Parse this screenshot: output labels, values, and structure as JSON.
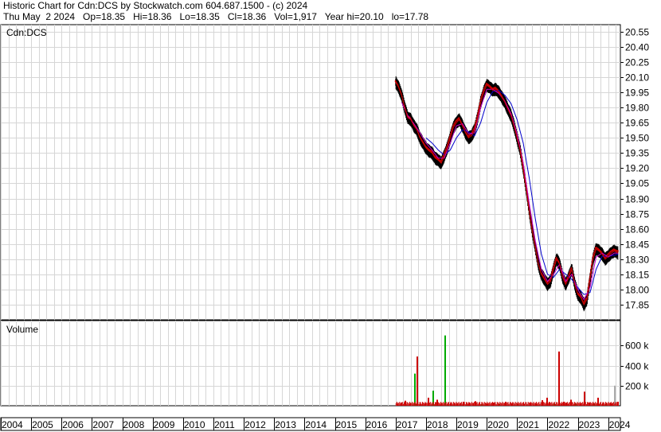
{
  "header": {
    "line1": "Historic Chart for Cdn:DCS by Stockwatch.com 604.687.1500 - (c) 2024",
    "line2": "Thu May  2 2024   Op=18.35   Hi=18.36   Lo=18.35   Cl=18.36   Vol=1,917   Year hi=20.10   lo=17.78"
  },
  "chart_data": [
    {
      "type": "line",
      "title": "Cdn:DCS",
      "ylim": [
        17.7,
        20.62
      ],
      "y_ticks": [
        "20.55",
        "20.40",
        "20.25",
        "20.10",
        "19.95",
        "19.80",
        "19.65",
        "19.50",
        "19.35",
        "19.20",
        "19.05",
        "18.90",
        "18.75",
        "18.60",
        "18.45",
        "18.30",
        "18.15",
        "18.00",
        "17.85"
      ],
      "x_ticks": [
        "2004",
        "2005",
        "2006",
        "2007",
        "2008",
        "2009",
        "2010",
        "2011",
        "2012",
        "2013",
        "2014",
        "2015",
        "2016",
        "2017",
        "2018",
        "2019",
        "2020",
        "2021",
        "2022",
        "2023",
        "2024"
      ],
      "xlim": [
        2004.0,
        2024.4
      ],
      "colors": {
        "price": "#cc0000",
        "ma_short": "#cc00cc",
        "ma_long": "#0000cc",
        "bar": "#000000"
      },
      "series": [
        {
          "kind": "price",
          "x": [
            2017.0,
            2017.1,
            2017.2,
            2017.3,
            2017.4,
            2017.5,
            2017.6,
            2017.7,
            2017.8,
            2017.9,
            2018.0,
            2018.1,
            2018.2,
            2018.3,
            2018.4,
            2018.5,
            2018.6,
            2018.7,
            2018.8,
            2018.9,
            2019.0,
            2019.1,
            2019.2,
            2019.3,
            2019.4,
            2019.5,
            2019.6,
            2019.7,
            2019.8,
            2019.9,
            2020.0,
            2020.1,
            2020.2,
            2020.3,
            2020.4,
            2020.5,
            2020.6,
            2020.7,
            2020.8,
            2020.9,
            2021.0,
            2021.1,
            2021.2,
            2021.3,
            2021.4,
            2021.5,
            2021.6,
            2021.7,
            2021.8,
            2021.9,
            2022.0,
            2022.1,
            2022.2,
            2022.3,
            2022.4,
            2022.5,
            2022.6,
            2022.7,
            2022.8,
            2022.9,
            2023.0,
            2023.1,
            2023.2,
            2023.3,
            2023.4,
            2023.5,
            2023.6,
            2023.7,
            2023.8,
            2023.9,
            2024.0,
            2024.1,
            2024.2,
            2024.33
          ],
          "y": [
            20.05,
            20.0,
            19.92,
            19.8,
            19.7,
            19.68,
            19.62,
            19.58,
            19.5,
            19.45,
            19.4,
            19.37,
            19.35,
            19.3,
            19.28,
            19.25,
            19.32,
            19.4,
            19.5,
            19.6,
            19.65,
            19.68,
            19.62,
            19.55,
            19.5,
            19.52,
            19.58,
            19.7,
            19.85,
            19.95,
            20.02,
            20.0,
            19.97,
            19.98,
            19.95,
            19.9,
            19.85,
            19.78,
            19.72,
            19.62,
            19.5,
            19.38,
            19.2,
            19.0,
            18.78,
            18.58,
            18.42,
            18.25,
            18.15,
            18.1,
            18.05,
            18.08,
            18.2,
            18.3,
            18.25,
            18.12,
            18.05,
            18.12,
            18.2,
            18.05,
            17.95,
            17.92,
            17.85,
            17.9,
            18.1,
            18.3,
            18.4,
            18.38,
            18.35,
            18.3,
            18.33,
            18.36,
            18.38,
            18.36
          ]
        },
        {
          "kind": "ma_short",
          "x": [
            2017.2,
            2017.4,
            2017.6,
            2017.8,
            2018.0,
            2018.2,
            2018.4,
            2018.6,
            2018.8,
            2019.0,
            2019.2,
            2019.4,
            2019.6,
            2019.8,
            2020.0,
            2020.2,
            2020.4,
            2020.6,
            2020.8,
            2021.0,
            2021.2,
            2021.4,
            2021.6,
            2021.8,
            2022.0,
            2022.2,
            2022.4,
            2022.6,
            2022.8,
            2023.0,
            2023.2,
            2023.4,
            2023.6,
            2023.8,
            2024.0,
            2024.2,
            2024.33
          ],
          "y": [
            19.85,
            19.72,
            19.64,
            19.55,
            19.45,
            19.38,
            19.3,
            19.3,
            19.45,
            19.62,
            19.64,
            19.54,
            19.55,
            19.8,
            19.98,
            19.98,
            19.94,
            19.86,
            19.74,
            19.54,
            19.25,
            18.85,
            18.48,
            18.2,
            18.08,
            18.15,
            18.25,
            18.08,
            18.15,
            18.0,
            17.9,
            18.02,
            18.32,
            18.36,
            18.32,
            18.36,
            18.36
          ]
        },
        {
          "kind": "ma_long",
          "x": [
            2018.0,
            2018.2,
            2018.4,
            2018.6,
            2018.8,
            2019.0,
            2019.2,
            2019.4,
            2019.6,
            2019.8,
            2020.0,
            2020.2,
            2020.4,
            2020.6,
            2020.8,
            2021.0,
            2021.2,
            2021.4,
            2021.6,
            2021.8,
            2022.0,
            2022.2,
            2022.4,
            2022.6,
            2022.8,
            2023.0,
            2023.2,
            2023.4,
            2023.6,
            2023.8,
            2024.0,
            2024.2,
            2024.33
          ],
          "y": [
            19.5,
            19.45,
            19.38,
            19.33,
            19.38,
            19.5,
            19.58,
            19.56,
            19.52,
            19.65,
            19.85,
            19.96,
            19.97,
            19.92,
            19.84,
            19.68,
            19.45,
            19.1,
            18.7,
            18.35,
            18.15,
            18.12,
            18.2,
            18.15,
            18.1,
            18.02,
            17.95,
            17.97,
            18.2,
            18.33,
            18.33,
            18.34,
            18.35
          ]
        }
      ]
    },
    {
      "type": "bar",
      "title": "Volume",
      "ylim": [
        0,
        800
      ],
      "y_ticks": [
        "600 k",
        "400 k",
        "200 k"
      ],
      "x": [
        2017.15,
        2017.3,
        2017.45,
        2017.6,
        2017.7,
        2017.8,
        2017.95,
        2018.05,
        2018.2,
        2018.35,
        2018.45,
        2018.6,
        2018.8,
        2019.0,
        2019.2,
        2019.4,
        2019.6,
        2019.8,
        2020.0,
        2020.2,
        2020.4,
        2020.6,
        2020.8,
        2021.0,
        2021.2,
        2021.4,
        2021.6,
        2021.8,
        2021.95,
        2022.05,
        2022.2,
        2022.35,
        2022.5,
        2022.6,
        2022.75,
        2022.9,
        2023.05,
        2023.2,
        2023.35,
        2023.5,
        2023.65,
        2023.8,
        2023.9,
        2024.05,
        2024.2,
        2024.3
      ],
      "values": [
        30,
        50,
        20,
        320,
        490,
        15,
        25,
        80,
        150,
        60,
        10,
        700,
        25,
        20,
        40,
        30,
        45,
        15,
        20,
        30,
        20,
        40,
        25,
        15,
        20,
        30,
        20,
        55,
        80,
        35,
        20,
        540,
        40,
        30,
        60,
        20,
        25,
        140,
        30,
        20,
        80,
        25,
        20,
        30,
        200,
        40
      ],
      "colors": [
        "#cc0000",
        "#cc0000",
        "#cc0000",
        "#00aa00",
        "#cc0000",
        "#cc0000",
        "#cc0000",
        "#cc0000",
        "#00aa00",
        "#cc0000",
        "#cc0000",
        "#00aa00",
        "#cc0000",
        "#cc0000",
        "#cc0000",
        "#cc0000",
        "#cc0000",
        "#00aa00",
        "#cc0000",
        "#cc0000",
        "#00aa00",
        "#cc0000",
        "#cc0000",
        "#00aa00",
        "#cc0000",
        "#cc0000",
        "#cc0000",
        "#cc0000",
        "#cc0000",
        "#cc0000",
        "#00aa00",
        "#cc0000",
        "#cc0000",
        "#cc0000",
        "#cc0000",
        "#00aa00",
        "#cc0000",
        "#cc0000",
        "#cc0000",
        "#00aa00",
        "#cc0000",
        "#cc0000",
        "#00aa00",
        "#cc0000",
        "#aaaaaa",
        "#cc0000"
      ]
    }
  ]
}
